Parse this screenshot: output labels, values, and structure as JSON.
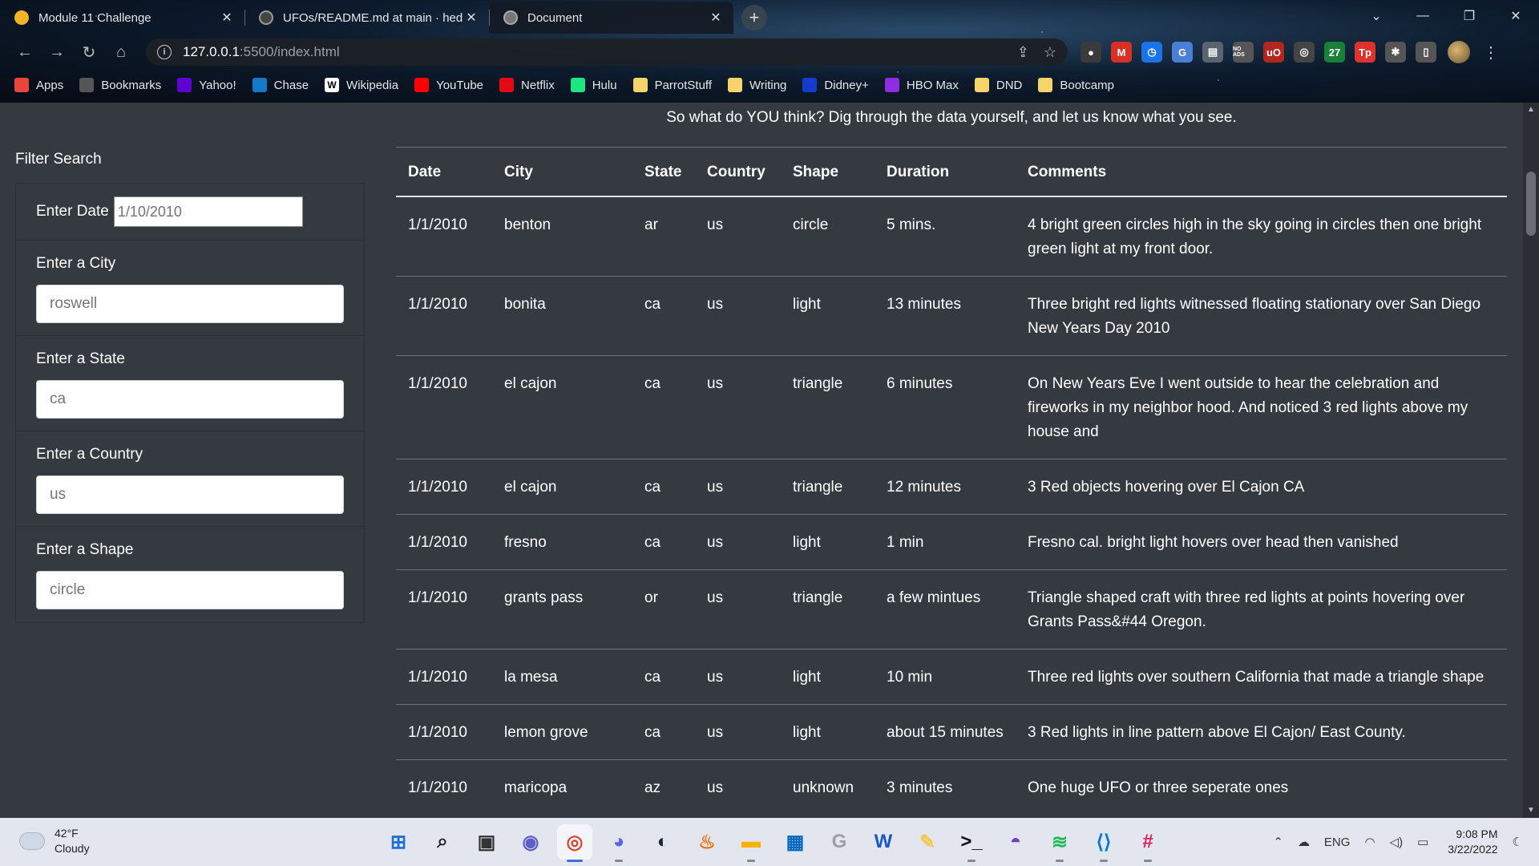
{
  "browser": {
    "tabs": [
      {
        "title": "Module 11 Challenge",
        "favicon_color": "#f2b32a",
        "active": false
      },
      {
        "title": "UFOs/README.md at main · hed",
        "favicon_color": "#444444",
        "active": false
      },
      {
        "title": "Document",
        "favicon_color": "#888888",
        "active": true
      }
    ],
    "new_tab_label": "+",
    "window_controls": {
      "chevron": "⌄",
      "minimize": "—",
      "restore": "❐",
      "close": "✕"
    },
    "address": {
      "host": "127.0.0.1",
      "path": ":5500/index.html"
    },
    "extensions": [
      {
        "label": "●",
        "color": "#3a3a3a"
      },
      {
        "label": "M",
        "color": "#d93025"
      },
      {
        "label": "◷",
        "color": "#1a73e8"
      },
      {
        "label": "G",
        "color": "#4a7fd8"
      },
      {
        "label": "▤",
        "color": "#5a6370"
      },
      {
        "label": "NO ADS",
        "color": "#555555"
      },
      {
        "label": "uO",
        "color": "#b3261e"
      },
      {
        "label": "◎",
        "color": "#444444"
      },
      {
        "label": "27",
        "color": "#188038"
      },
      {
        "label": "Tp",
        "color": "#e0322c"
      },
      {
        "label": "✱",
        "color": "#555555"
      },
      {
        "label": "▯",
        "color": "#555555"
      }
    ],
    "bookmarks": [
      {
        "label": "Apps",
        "icon": "apps-grid-icon",
        "color": "#e8453c"
      },
      {
        "label": "Bookmarks",
        "icon": "star-icon",
        "color": "#555555"
      },
      {
        "label": "Yahoo!",
        "icon": "yahoo-icon",
        "color": "#6001d2"
      },
      {
        "label": "Chase",
        "icon": "chase-icon",
        "color": "#117aca"
      },
      {
        "label": "Wikipedia",
        "icon": "wikipedia-icon",
        "color": "#ffffff"
      },
      {
        "label": "YouTube",
        "icon": "youtube-icon",
        "color": "#ff0000"
      },
      {
        "label": "Netflix",
        "icon": "netflix-icon",
        "color": "#e50914"
      },
      {
        "label": "Hulu",
        "icon": "hulu-icon",
        "color": "#1ce783"
      },
      {
        "label": "ParrotStuff",
        "icon": "folder-icon",
        "color": "#f6d36b"
      },
      {
        "label": "Writing",
        "icon": "folder-icon",
        "color": "#f6d36b"
      },
      {
        "label": "Didney+",
        "icon": "disney-icon",
        "color": "#113ccf"
      },
      {
        "label": "HBO Max",
        "icon": "hbomax-icon",
        "color": "#8e2de2"
      },
      {
        "label": "DND",
        "icon": "folder-icon",
        "color": "#f6d36b"
      },
      {
        "label": "Bootcamp",
        "icon": "folder-icon",
        "color": "#f6d36b"
      }
    ]
  },
  "page": {
    "intro": "So what do YOU think? Dig through the data yourself, and let us know what you see.",
    "filter_title": "Filter Search",
    "filters": {
      "date": {
        "label": "Enter Date",
        "placeholder": "1/10/2010"
      },
      "city": {
        "label": "Enter a City",
        "placeholder": "roswell"
      },
      "state": {
        "label": "Enter a State",
        "placeholder": "ca"
      },
      "country": {
        "label": "Enter a Country",
        "placeholder": "us"
      },
      "shape": {
        "label": "Enter a Shape",
        "placeholder": "circle"
      }
    },
    "table": {
      "headers": [
        "Date",
        "City",
        "State",
        "Country",
        "Shape",
        "Duration",
        "Comments"
      ],
      "rows": [
        [
          "1/1/2010",
          "benton",
          "ar",
          "us",
          "circle",
          "5 mins.",
          "4 bright green circles high in the sky going in circles then one bright green light at my front door."
        ],
        [
          "1/1/2010",
          "bonita",
          "ca",
          "us",
          "light",
          "13 minutes",
          "Three bright red lights witnessed floating stationary over San Diego New Years Day 2010"
        ],
        [
          "1/1/2010",
          "el cajon",
          "ca",
          "us",
          "triangle",
          "6 minutes",
          "On New Years Eve I went outside to hear the celebration and fireworks in my neighbor hood. And noticed 3 red lights above my house and"
        ],
        [
          "1/1/2010",
          "el cajon",
          "ca",
          "us",
          "triangle",
          "12 minutes",
          "3 Red objects hovering over El Cajon CA"
        ],
        [
          "1/1/2010",
          "fresno",
          "ca",
          "us",
          "light",
          "1 min",
          "Fresno cal. bright light hovers over head then vanished"
        ],
        [
          "1/1/2010",
          "grants pass",
          "or",
          "us",
          "triangle",
          "a few mintues",
          "Triangle shaped craft with three red lights at points hovering over Grants Pass&#44 Oregon."
        ],
        [
          "1/1/2010",
          "la mesa",
          "ca",
          "us",
          "light",
          "10 min",
          "Three red lights over southern California that made a triangle shape"
        ],
        [
          "1/1/2010",
          "lemon grove",
          "ca",
          "us",
          "light",
          "about 15 minutes",
          "3 Red lights in line pattern above El Cajon/ East County."
        ],
        [
          "1/1/2010",
          "maricopa",
          "az",
          "us",
          "unknown",
          "3 minutes",
          "One huge UFO or three seperate ones"
        ]
      ]
    }
  },
  "taskbar": {
    "weather": {
      "temp": "42°F",
      "condition": "Cloudy"
    },
    "apps": [
      {
        "name": "start",
        "label": "⊞",
        "color": "#1a6fd8"
      },
      {
        "name": "search",
        "label": "⌕",
        "color": "#222222"
      },
      {
        "name": "task-view",
        "label": "▣",
        "color": "#333333"
      },
      {
        "name": "teams-chat",
        "label": "◉",
        "color": "#5b5fc7"
      },
      {
        "name": "chrome",
        "label": "◎",
        "color": "#db4437"
      },
      {
        "name": "discord",
        "label": "◕",
        "color": "#5865f2"
      },
      {
        "name": "steam",
        "label": "◐",
        "color": "#1b2838"
      },
      {
        "name": "app-flame",
        "label": "♨",
        "color": "#e8710a"
      },
      {
        "name": "file-explorer",
        "label": "▬",
        "color": "#f4b400"
      },
      {
        "name": "store",
        "label": "▦",
        "color": "#0067c0"
      },
      {
        "name": "app-g",
        "label": "G",
        "color": "#9aa0a6"
      },
      {
        "name": "word",
        "label": "W",
        "color": "#185abd"
      },
      {
        "name": "app-feather",
        "label": "✎",
        "color": "#f2c94c"
      },
      {
        "name": "terminal",
        "label": ">_",
        "color": "#111111"
      },
      {
        "name": "github-desktop",
        "label": "◓",
        "color": "#6e40c9"
      },
      {
        "name": "spotify",
        "label": "≋",
        "color": "#1db954"
      },
      {
        "name": "vscode",
        "label": "⟨⟩",
        "color": "#0078d4"
      },
      {
        "name": "slack",
        "label": "#",
        "color": "#e01e5a"
      }
    ],
    "tray": {
      "language": "ENG",
      "time": "9:08 PM",
      "date": "3/22/2022"
    }
  }
}
